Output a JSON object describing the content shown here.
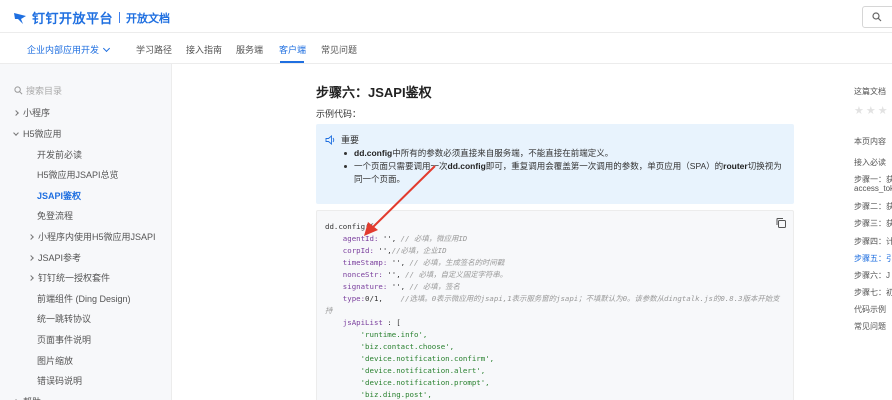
{
  "header": {
    "logo_text": "钉钉开放平台",
    "logo_sub": "开放文档"
  },
  "nav": {
    "items": [
      {
        "label": "企业内部应用开发"
      },
      {
        "label": "学习路径"
      },
      {
        "label": "接入指南"
      },
      {
        "label": "服务端"
      },
      {
        "label": "客户端"
      },
      {
        "label": "常见问题"
      }
    ]
  },
  "sidebar": {
    "search_placeholder": "搜索目录",
    "items": [
      {
        "label": "小程序"
      },
      {
        "label": "H5微应用"
      },
      {
        "label": "开发前必读"
      },
      {
        "label": "H5微应用JSAPI总览"
      },
      {
        "label": "JSAPI鉴权"
      },
      {
        "label": "免登流程"
      },
      {
        "label": "小程序内使用H5微应用JSAPI"
      },
      {
        "label": "JSAPI参考"
      },
      {
        "label": "钉钉统一授权套件"
      },
      {
        "label": "前端组件 (Ding Design)"
      },
      {
        "label": "统一跳转协议"
      },
      {
        "label": "页面事件说明"
      },
      {
        "label": "图片缩放"
      },
      {
        "label": "错误码说明"
      },
      {
        "label": "帮助"
      }
    ]
  },
  "main": {
    "title": "步骤六：JSAPI鉴权",
    "example_label": "示例代码：",
    "notice": {
      "heading": "重要",
      "item1_bold": "dd.config",
      "item1_rest": "中所有的参数必须直接来自服务端，不能直接在前端定义。",
      "item2_pre": "一个页面只需要调用一次",
      "item2_bold1": "dd.config",
      "item2_mid": "即可，重复调用会覆盖第一次调用的参数，单页应用（SPA）的",
      "item2_bold2": "router",
      "item2_post": "切换视为同一个页面。"
    },
    "code": {
      "l1": "dd.config({",
      "l2k": "    agentId:",
      "l2v": " '',",
      "l2c": " // 必填，微应用ID",
      "l3k": "    corpId:",
      "l3v": " '',",
      "l3c": "//必填，企业ID",
      "l4k": "    timeStamp:",
      "l4v": " '',",
      "l4c": " // 必填，生成签名的时间戳",
      "l5k": "    nonceStr:",
      "l5v": " '',",
      "l5c": " // 必填，自定义固定字符串。",
      "l6k": "    signature:",
      "l6v": " '',",
      "l6c": " // 必填，签名",
      "l7k": "    type:",
      "l7v": "0/1,",
      "l7c": "    //选填。0表示微应用的jsapi,1表示服务窗的jsapi；不填默认为0。该参数从dingtalk.js的0.8.3版本开始支",
      "l8c": "持",
      "l9k": "    jsApiList",
      "l9v": " : [",
      "l10": "        'runtime.info',",
      "l11": "        'biz.contact.choose',",
      "l12": "        'device.notification.confirm',",
      "l13": "        'device.notification.alert',",
      "l14": "        'device.notification.prompt',",
      "l15": "        'biz.ding.post',"
    }
  },
  "right_panel": {
    "doc_help": "这篇文档",
    "toc_title": "本页内容",
    "toc": [
      {
        "label": "接入必读"
      },
      {
        "label": "步骤一：获"
      },
      {
        "label": "access_tok"
      },
      {
        "label": "步骤二：获"
      },
      {
        "label": "步骤三：获"
      },
      {
        "label": "步骤四：计"
      },
      {
        "label": "步骤五：引"
      },
      {
        "label": "步骤六：J"
      },
      {
        "label": "步骤七：初"
      },
      {
        "label": "代码示例"
      },
      {
        "label": "常见问题"
      }
    ]
  },
  "colors": {
    "accent": "#1f6fe0",
    "annotation": "#e23b2e"
  }
}
